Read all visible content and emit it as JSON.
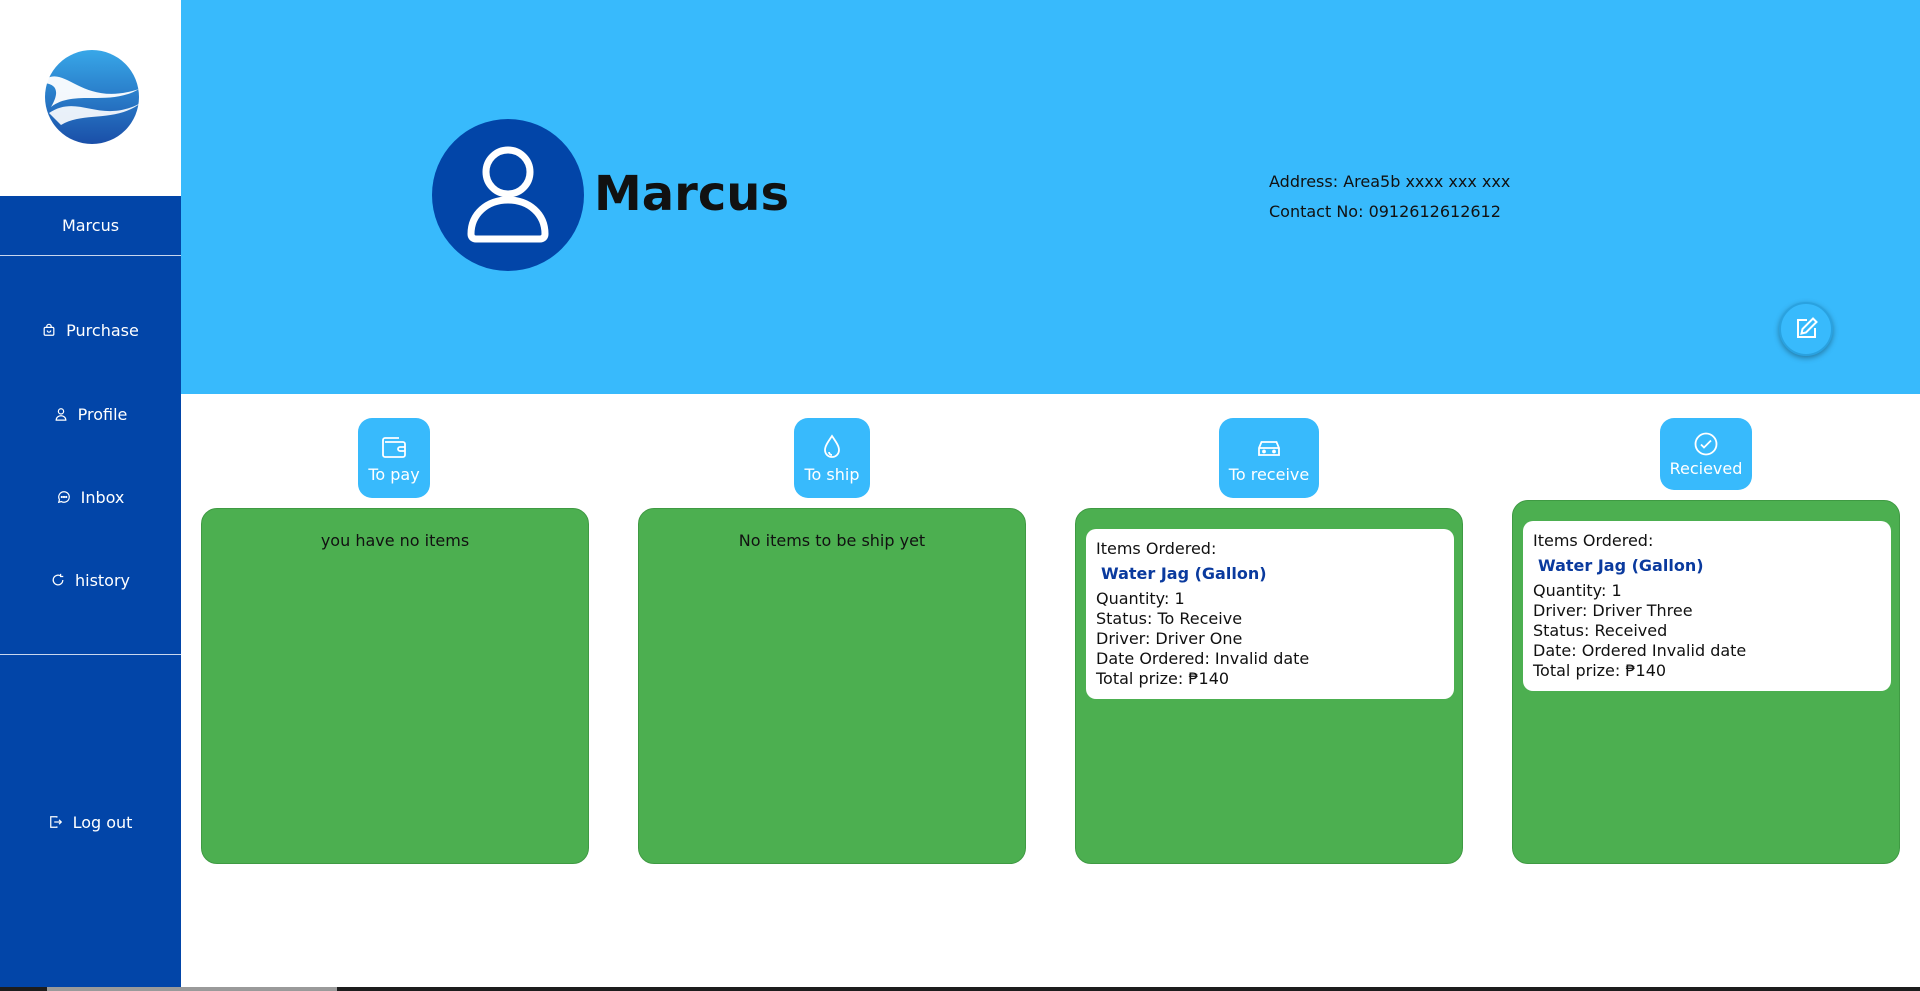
{
  "sidebar": {
    "logo_icon": "wave-globe-logo",
    "user_name": "Marcus",
    "items": [
      {
        "label": "Purchase",
        "icon": "shopping-bag-icon"
      },
      {
        "label": "Profile",
        "icon": "user-icon"
      },
      {
        "label": "Inbox",
        "icon": "chat-icon"
      },
      {
        "label": "history",
        "icon": "refresh-icon"
      }
    ],
    "logout_label": "Log out"
  },
  "profile": {
    "name": "Marcus",
    "address": "Address: Area5b xxxx xxx xxx",
    "contact": "Contact No: 0912612612612",
    "edit_icon": "edit-icon"
  },
  "tabs": {
    "to_pay": "To pay",
    "to_ship": "To ship",
    "to_receive": "To receive",
    "received": "Recieved"
  },
  "panels": {
    "to_pay_empty": "you have no items",
    "to_ship_empty": "No items to be ship yet",
    "to_receive_order": {
      "heading": "Items Ordered:",
      "item": "Water Jag (Gallon)",
      "quantity": "Quantity: 1",
      "status": "Status: To Receive",
      "driver": "Driver: Driver One",
      "date": "Date Ordered: Invalid date",
      "total": "Total prize: ₱140"
    },
    "received_order": {
      "heading": "Items Ordered:",
      "item": "Water Jag (Gallon)",
      "quantity": "Quantity: 1",
      "driver": "Driver: Driver Three",
      "status": "Status: Received",
      "date": "Date: Ordered Invalid date",
      "total": "Total prize: ₱140"
    }
  },
  "colors": {
    "sidebar": "#0245a8",
    "header": "#38bafc",
    "panel": "#4caf50",
    "item_name": "#0a3a9e"
  }
}
